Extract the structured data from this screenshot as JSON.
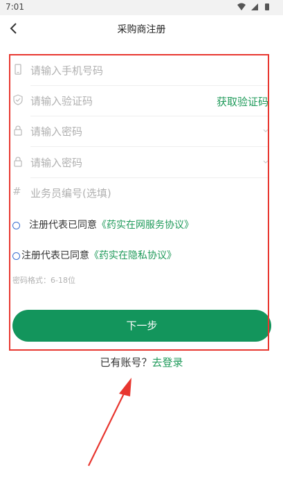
{
  "status": {
    "time": "7:01"
  },
  "nav": {
    "title": "采购商注册"
  },
  "form": {
    "phone_placeholder": "请输入手机号码",
    "code_placeholder": "请输入验证码",
    "get_code_label": "获取验证码",
    "password_placeholder": "请输入密码",
    "confirm_password_placeholder": "请输入密码",
    "agent_placeholder": "业务员编号(选填)",
    "agree1_text": "注册代表已同意",
    "agree1_link": "《药实在网服务协议》",
    "agree2_text": "注册代表已同意",
    "agree2_link": "《药实在隐私协议》",
    "password_hint": "密码格式：6-18位",
    "next_label": "下一步"
  },
  "footer": {
    "has_account": "已有账号？",
    "login_link": "去登录"
  },
  "colors": {
    "accent": "#13955c",
    "annotation": "#e8362f"
  }
}
